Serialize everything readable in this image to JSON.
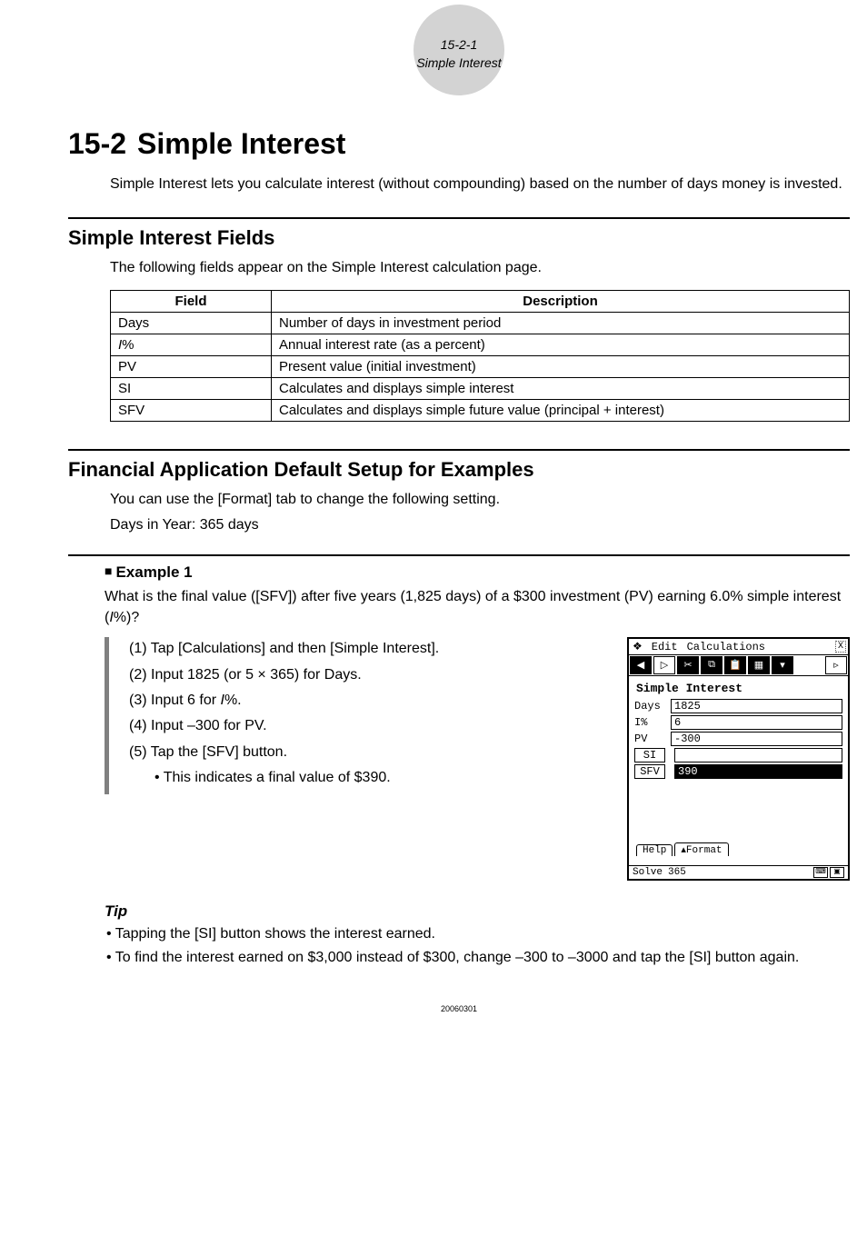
{
  "header": {
    "page_ref": "15-2-1",
    "topic": "Simple Interest"
  },
  "chapter": {
    "number": "15-2",
    "title": "Simple Interest",
    "intro": "Simple Interest lets you calculate interest (without compounding) based on the number of days money is invested."
  },
  "section_fields": {
    "title": "Simple Interest Fields",
    "desc": "The following fields appear on the Simple Interest calculation page.",
    "table": {
      "headers": {
        "field": "Field",
        "desc": "Description"
      },
      "rows": [
        {
          "field": "Days",
          "desc": "Number of days in investment period"
        },
        {
          "field_html": "<span class='ivar'>I</span>%",
          "field": "I%",
          "desc": "Annual interest rate (as a percent)"
        },
        {
          "field": "PV",
          "desc": "Present value (initial investment)"
        },
        {
          "field": "SI",
          "desc": "Calculates and displays simple interest"
        },
        {
          "field": "SFV",
          "desc": "Calculates and displays simple future value (principal + interest)"
        }
      ]
    }
  },
  "section_setup": {
    "title": "Financial Application Default Setup for Examples",
    "line1": "You can use the [Format] tab to change the following setting.",
    "line2": "Days in Year: 365 days"
  },
  "example1": {
    "heading": "Example 1",
    "question": "What is the final value ([SFV]) after five years (1,825 days) of a $300 investment (PV) earning 6.0% simple interest (I%)?",
    "steps": [
      "(1) Tap [Calculations] and then [Simple Interest].",
      "(2) Input 1825 (or 5 × 365) for Days.",
      "(3) Input 6 for I%.",
      "(4) Input –300 for PV.",
      "(5) Tap the [SFV] button."
    ],
    "result_note": "• This indicates a final value of $390."
  },
  "screenshot": {
    "menus": {
      "m1": "Edit",
      "m2": "Calculations"
    },
    "title": "Simple Interest",
    "fields": {
      "days_label": "Days",
      "days_val": "1825",
      "ipct_label": "I%",
      "ipct_val": "6",
      "pv_label": "PV",
      "pv_val": "-300",
      "si_label": "SI",
      "si_val": "",
      "sfv_label": "SFV",
      "sfv_val": "390"
    },
    "tabs": {
      "help": "Help",
      "format": "▴Format"
    },
    "status": {
      "left": "Solve",
      "right": "365"
    }
  },
  "tip": {
    "title": "Tip",
    "items": [
      "• Tapping the [SI] button shows the interest earned.",
      "• To find the interest earned on $3,000 instead of $300, change –300 to –3000 and tap the [SI] button again."
    ]
  },
  "footer": {
    "code": "20060301"
  }
}
